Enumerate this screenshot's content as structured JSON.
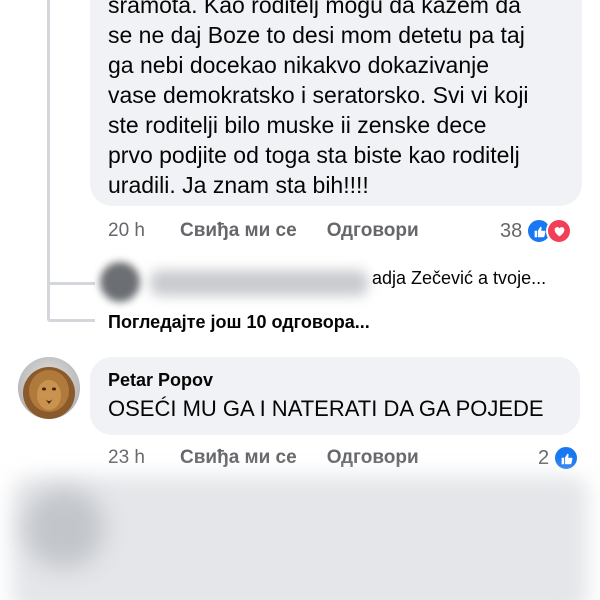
{
  "comment1": {
    "lines": [
      "sramota. Kao roditelj mogu da kazem da",
      "se ne daj Boze to desi mom detetu pa taj",
      "ga nebi docekao nikakvo dokazivanje",
      "vase demokratsko i seratorsko. Svi vi koji",
      "ste roditelji bilo muske ii zenske dece",
      "prvo podjite od toga sta biste kao roditelj",
      "uradili. Ja znam sta bih!!!!"
    ],
    "time": "20 h",
    "like_label": "Свиђа ми се",
    "reply_label": "Одговори",
    "reaction_count": "38",
    "reply_preview_text": "adja Zečević a tvoje...",
    "view_more_label": "Погледајте још 10 одговора..."
  },
  "comment2": {
    "author": "Petar Popov",
    "text": "OSEĆI MU GA I NATERATI DA GA POJEDE",
    "time": "23 h",
    "like_label": "Свиђа ми се",
    "reply_label": "Одговори",
    "reaction_count": "2"
  },
  "colors": {
    "bubble": "#f0f2f5",
    "meta": "#65676b",
    "like": "#1877f2",
    "love": "#f33e58"
  }
}
